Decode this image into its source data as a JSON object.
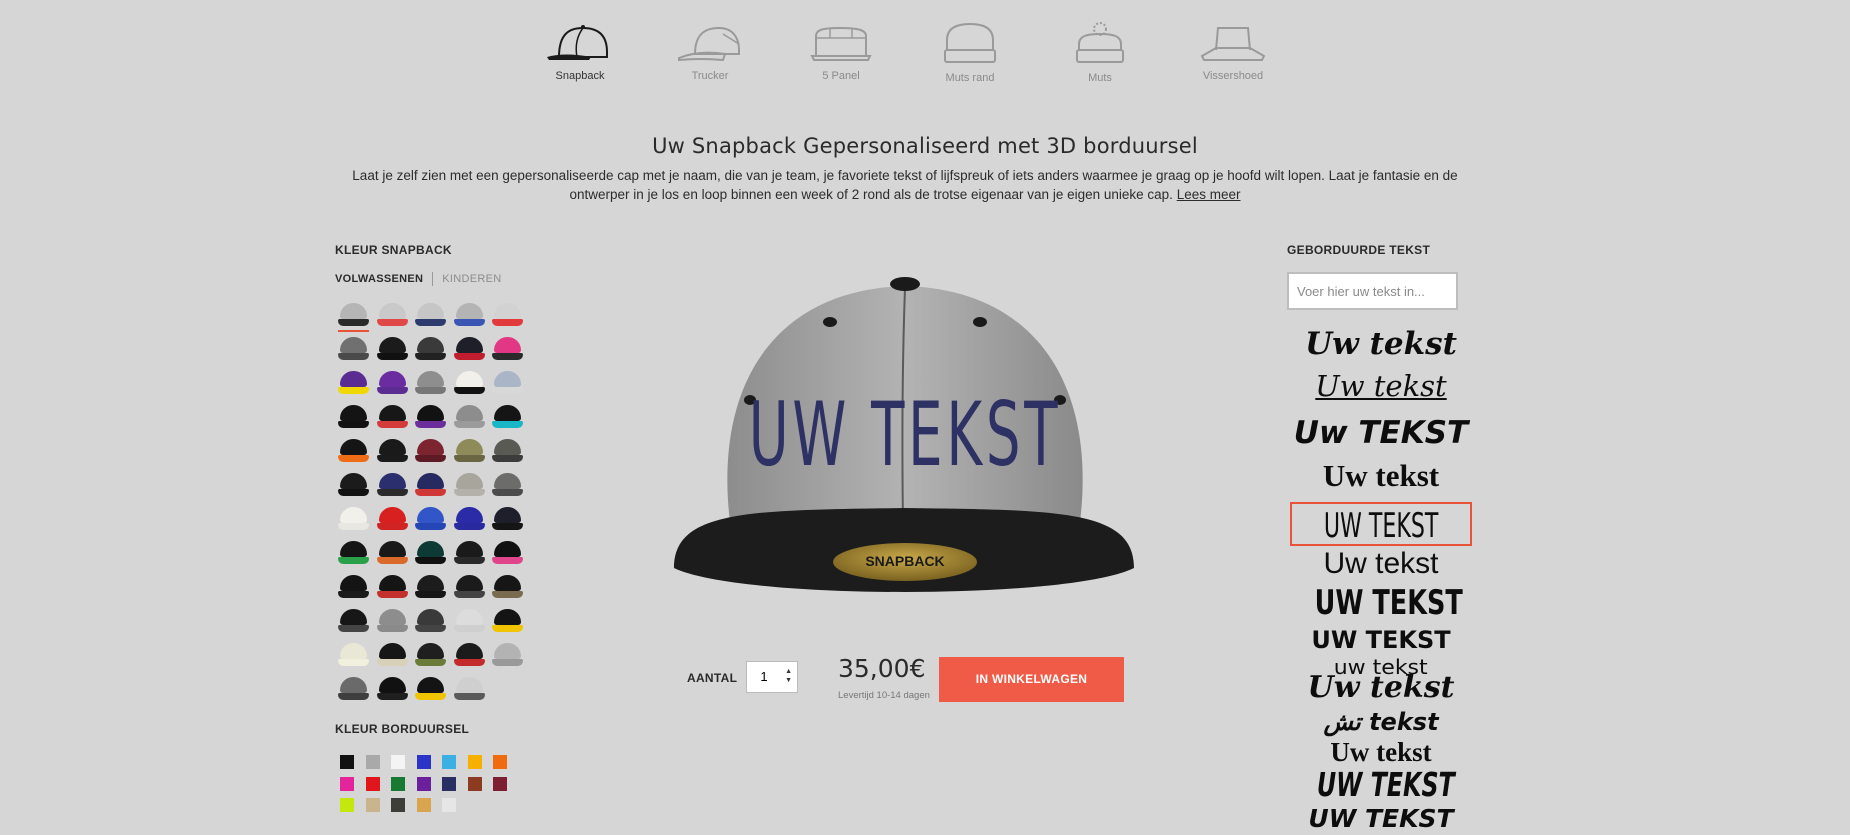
{
  "nav": [
    {
      "label": "Snapback",
      "icon": "snapback-cap-icon",
      "active": true
    },
    {
      "label": "Trucker",
      "icon": "trucker-cap-icon",
      "active": false
    },
    {
      "label": "5 Panel",
      "icon": "five-panel-cap-icon",
      "active": false
    },
    {
      "label": "Muts rand",
      "icon": "beanie-cuff-icon",
      "active": false
    },
    {
      "label": "Muts",
      "icon": "pom-beanie-icon",
      "active": false
    },
    {
      "label": "Vissershoed",
      "icon": "bucket-hat-icon",
      "active": false
    }
  ],
  "title": "Uw Snapback Gepersonaliseerd met 3D borduursel",
  "description": {
    "text": "Laat je zelf zien met een gepersonaliseerde cap met je naam, die van je team, je favoriete tekst of lijfspreuk of iets anders waarmee je graag op je hoofd wilt lopen. Laat je fantasie en de ontwerper in je los en loop binnen een week of 2 rond als de trotse eigenaar van je eigen unieke cap.",
    "link": "Lees meer"
  },
  "color_section": {
    "heading": "KLEUR SNAPBACK",
    "tabs": [
      "VOLWASSENEN",
      "KINDEREN"
    ],
    "active_tab": 0,
    "selected_index": 0,
    "swatches": [
      [
        "#b5b5b5",
        "#2a2a2a"
      ],
      [
        "#c9c9c9",
        "#e04848"
      ],
      [
        "#c6c6c6",
        "#2c3a6e"
      ],
      [
        "#b4b4b4",
        "#3b55b5"
      ],
      [
        "#d2d2d2",
        "#e23a3a"
      ],
      [
        "#707070",
        "#4a4a4a"
      ],
      [
        "#1b1b1b",
        "#111111"
      ],
      [
        "#3a3a3a",
        "#222222"
      ],
      [
        "#1f1f2a",
        "#c11d2e"
      ],
      [
        "#e23784",
        "#2a2a2a"
      ],
      [
        "#5b2c91",
        "#f0d800"
      ],
      [
        "#6a2ca0",
        "#5b2c91"
      ],
      [
        "#8e8e8e",
        "#777777"
      ],
      [
        "#f2f0ea",
        "#121212"
      ],
      [
        "#aab6c8",
        "#d8d8d8"
      ],
      [
        "#141414",
        "#121212"
      ],
      [
        "#171717",
        "#d43b3b"
      ],
      [
        "#121212",
        "#6b2e9b"
      ],
      [
        "#8d8d8d",
        "#9b9b9b"
      ],
      [
        "#151515",
        "#19b6c7"
      ],
      [
        "#151515",
        "#f06d18"
      ],
      [
        "#1a1a1a",
        "#1b1b1b"
      ],
      [
        "#7c2430",
        "#5f1b25"
      ],
      [
        "#8f8a5a",
        "#6a6644"
      ],
      [
        "#5a5a55",
        "#3c3c3c"
      ],
      [
        "#1b1b1b",
        "#121212"
      ],
      [
        "#2b2f6e",
        "#2b2b2b"
      ],
      [
        "#262a60",
        "#d03838"
      ],
      [
        "#a8a59c",
        "#b3b1a9"
      ],
      [
        "#6c6c6a",
        "#4b4b4b"
      ],
      [
        "#f2f0ea",
        "#e9e7e1"
      ],
      [
        "#d82020",
        "#d02424"
      ],
      [
        "#3255c8",
        "#2447b5"
      ],
      [
        "#2b2ba8",
        "#2a2aa0"
      ],
      [
        "#1f1f2c",
        "#151515"
      ],
      [
        "#151515",
        "#2aa04a"
      ],
      [
        "#191919",
        "#d96a2a"
      ],
      [
        "#0d3a35",
        "#111111"
      ],
      [
        "#1a1a1a",
        "#2a2a2a"
      ],
      [
        "#111111",
        "#e0458c"
      ],
      [
        "#141414",
        "#1a1a1a"
      ],
      [
        "#151515",
        "#c4302b"
      ],
      [
        "#1c1c1c",
        "#161616"
      ],
      [
        "#1b1b1b",
        "#444444"
      ],
      [
        "#161616",
        "#7a6a50"
      ],
      [
        "#171717",
        "#444444"
      ],
      [
        "#8d8d8d",
        "#8a8a8a"
      ],
      [
        "#3a3a3a",
        "#444444"
      ],
      [
        "#dcdcdc",
        "#cfcfcf"
      ],
      [
        "#141414",
        "#f0c400"
      ],
      [
        "#e9e7d5",
        "#f1efde"
      ],
      [
        "#161616",
        "#d8d0b8"
      ],
      [
        "#1f1f1f",
        "#6b7b3a"
      ],
      [
        "#1b1b1b",
        "#c42b2b"
      ],
      [
        "#b3b3b3",
        "#999999"
      ],
      [
        "#6a6a6a",
        "#3e3e3e"
      ],
      [
        "#111111",
        "#1f1f1f"
      ],
      [
        "#141414",
        "#f0c400"
      ],
      [
        "#cfcfcf",
        "#5a5a5a"
      ]
    ]
  },
  "embroidery_section": {
    "heading": "KLEUR BORDUURSEL",
    "colors": [
      "#111111",
      "#a9a9a9",
      "#f4f4f4",
      "#2c33c9",
      "#3cb0e2",
      "#f7b000",
      "#f06a10",
      "#e3249a",
      "#e0161c",
      "#167a33",
      "#6a209c",
      "#2a2f63",
      "#8c3a22",
      "#7d1e33",
      "#c4e80e",
      "#c9b48d",
      "#3d3d3a",
      "#d9a64f",
      "#e6e6e6"
    ]
  },
  "product": {
    "cap_text": "UW TEKST",
    "brim_logo": "SNAPBACK",
    "crown_color": "#a8a8a8",
    "brim_color": "#1a1a1a",
    "text_color": "#2e3164"
  },
  "purchase": {
    "qty_label": "AANTAL",
    "qty_value": "1",
    "price": "35,00€",
    "delivery": "Levertijd 10-14 dagen",
    "cart_button": "IN WINKELWAGEN"
  },
  "text_section": {
    "heading": "GEBORDUURDE TEKST",
    "placeholder": "Voer hier uw tekst in...",
    "selected_font": 4,
    "font_samples": [
      "Uw tekst",
      "Uw tekst",
      "Uw TEKST",
      "Uw tekst",
      "UW TEKST",
      "Uw tekst",
      "UW TEKST",
      "UW TEKST",
      "uw tekst",
      "Uw tekst",
      "تش tekst",
      "Uw tekst",
      "UW TEKST",
      "UW TEKST"
    ]
  },
  "accent_color": "#f05b47"
}
